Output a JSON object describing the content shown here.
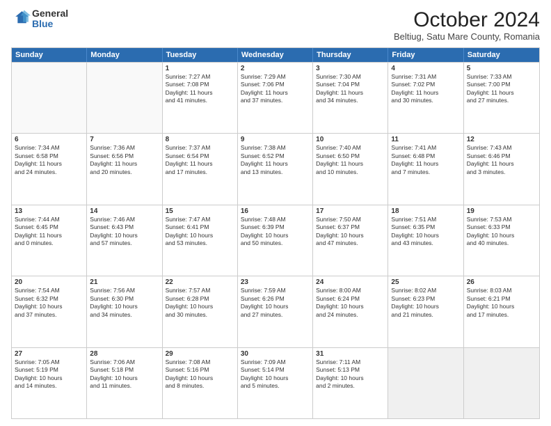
{
  "logo": {
    "general": "General",
    "blue": "Blue"
  },
  "title": "October 2024",
  "subtitle": "Beltiug, Satu Mare County, Romania",
  "days": [
    "Sunday",
    "Monday",
    "Tuesday",
    "Wednesday",
    "Thursday",
    "Friday",
    "Saturday"
  ],
  "rows": [
    [
      {
        "day": "",
        "lines": [],
        "empty": true
      },
      {
        "day": "",
        "lines": [],
        "empty": true
      },
      {
        "day": "1",
        "lines": [
          "Sunrise: 7:27 AM",
          "Sunset: 7:08 PM",
          "Daylight: 11 hours",
          "and 41 minutes."
        ]
      },
      {
        "day": "2",
        "lines": [
          "Sunrise: 7:29 AM",
          "Sunset: 7:06 PM",
          "Daylight: 11 hours",
          "and 37 minutes."
        ]
      },
      {
        "day": "3",
        "lines": [
          "Sunrise: 7:30 AM",
          "Sunset: 7:04 PM",
          "Daylight: 11 hours",
          "and 34 minutes."
        ]
      },
      {
        "day": "4",
        "lines": [
          "Sunrise: 7:31 AM",
          "Sunset: 7:02 PM",
          "Daylight: 11 hours",
          "and 30 minutes."
        ]
      },
      {
        "day": "5",
        "lines": [
          "Sunrise: 7:33 AM",
          "Sunset: 7:00 PM",
          "Daylight: 11 hours",
          "and 27 minutes."
        ]
      }
    ],
    [
      {
        "day": "6",
        "lines": [
          "Sunrise: 7:34 AM",
          "Sunset: 6:58 PM",
          "Daylight: 11 hours",
          "and 24 minutes."
        ]
      },
      {
        "day": "7",
        "lines": [
          "Sunrise: 7:36 AM",
          "Sunset: 6:56 PM",
          "Daylight: 11 hours",
          "and 20 minutes."
        ]
      },
      {
        "day": "8",
        "lines": [
          "Sunrise: 7:37 AM",
          "Sunset: 6:54 PM",
          "Daylight: 11 hours",
          "and 17 minutes."
        ]
      },
      {
        "day": "9",
        "lines": [
          "Sunrise: 7:38 AM",
          "Sunset: 6:52 PM",
          "Daylight: 11 hours",
          "and 13 minutes."
        ]
      },
      {
        "day": "10",
        "lines": [
          "Sunrise: 7:40 AM",
          "Sunset: 6:50 PM",
          "Daylight: 11 hours",
          "and 10 minutes."
        ]
      },
      {
        "day": "11",
        "lines": [
          "Sunrise: 7:41 AM",
          "Sunset: 6:48 PM",
          "Daylight: 11 hours",
          "and 7 minutes."
        ]
      },
      {
        "day": "12",
        "lines": [
          "Sunrise: 7:43 AM",
          "Sunset: 6:46 PM",
          "Daylight: 11 hours",
          "and 3 minutes."
        ]
      }
    ],
    [
      {
        "day": "13",
        "lines": [
          "Sunrise: 7:44 AM",
          "Sunset: 6:45 PM",
          "Daylight: 11 hours",
          "and 0 minutes."
        ]
      },
      {
        "day": "14",
        "lines": [
          "Sunrise: 7:46 AM",
          "Sunset: 6:43 PM",
          "Daylight: 10 hours",
          "and 57 minutes."
        ]
      },
      {
        "day": "15",
        "lines": [
          "Sunrise: 7:47 AM",
          "Sunset: 6:41 PM",
          "Daylight: 10 hours",
          "and 53 minutes."
        ]
      },
      {
        "day": "16",
        "lines": [
          "Sunrise: 7:48 AM",
          "Sunset: 6:39 PM",
          "Daylight: 10 hours",
          "and 50 minutes."
        ]
      },
      {
        "day": "17",
        "lines": [
          "Sunrise: 7:50 AM",
          "Sunset: 6:37 PM",
          "Daylight: 10 hours",
          "and 47 minutes."
        ]
      },
      {
        "day": "18",
        "lines": [
          "Sunrise: 7:51 AM",
          "Sunset: 6:35 PM",
          "Daylight: 10 hours",
          "and 43 minutes."
        ]
      },
      {
        "day": "19",
        "lines": [
          "Sunrise: 7:53 AM",
          "Sunset: 6:33 PM",
          "Daylight: 10 hours",
          "and 40 minutes."
        ]
      }
    ],
    [
      {
        "day": "20",
        "lines": [
          "Sunrise: 7:54 AM",
          "Sunset: 6:32 PM",
          "Daylight: 10 hours",
          "and 37 minutes."
        ]
      },
      {
        "day": "21",
        "lines": [
          "Sunrise: 7:56 AM",
          "Sunset: 6:30 PM",
          "Daylight: 10 hours",
          "and 34 minutes."
        ]
      },
      {
        "day": "22",
        "lines": [
          "Sunrise: 7:57 AM",
          "Sunset: 6:28 PM",
          "Daylight: 10 hours",
          "and 30 minutes."
        ]
      },
      {
        "day": "23",
        "lines": [
          "Sunrise: 7:59 AM",
          "Sunset: 6:26 PM",
          "Daylight: 10 hours",
          "and 27 minutes."
        ]
      },
      {
        "day": "24",
        "lines": [
          "Sunrise: 8:00 AM",
          "Sunset: 6:24 PM",
          "Daylight: 10 hours",
          "and 24 minutes."
        ]
      },
      {
        "day": "25",
        "lines": [
          "Sunrise: 8:02 AM",
          "Sunset: 6:23 PM",
          "Daylight: 10 hours",
          "and 21 minutes."
        ]
      },
      {
        "day": "26",
        "lines": [
          "Sunrise: 8:03 AM",
          "Sunset: 6:21 PM",
          "Daylight: 10 hours",
          "and 17 minutes."
        ]
      }
    ],
    [
      {
        "day": "27",
        "lines": [
          "Sunrise: 7:05 AM",
          "Sunset: 5:19 PM",
          "Daylight: 10 hours",
          "and 14 minutes."
        ]
      },
      {
        "day": "28",
        "lines": [
          "Sunrise: 7:06 AM",
          "Sunset: 5:18 PM",
          "Daylight: 10 hours",
          "and 11 minutes."
        ]
      },
      {
        "day": "29",
        "lines": [
          "Sunrise: 7:08 AM",
          "Sunset: 5:16 PM",
          "Daylight: 10 hours",
          "and 8 minutes."
        ]
      },
      {
        "day": "30",
        "lines": [
          "Sunrise: 7:09 AM",
          "Sunset: 5:14 PM",
          "Daylight: 10 hours",
          "and 5 minutes."
        ]
      },
      {
        "day": "31",
        "lines": [
          "Sunrise: 7:11 AM",
          "Sunset: 5:13 PM",
          "Daylight: 10 hours",
          "and 2 minutes."
        ]
      },
      {
        "day": "",
        "lines": [],
        "empty": true,
        "shaded": true
      },
      {
        "day": "",
        "lines": [],
        "empty": true,
        "shaded": true
      }
    ]
  ]
}
